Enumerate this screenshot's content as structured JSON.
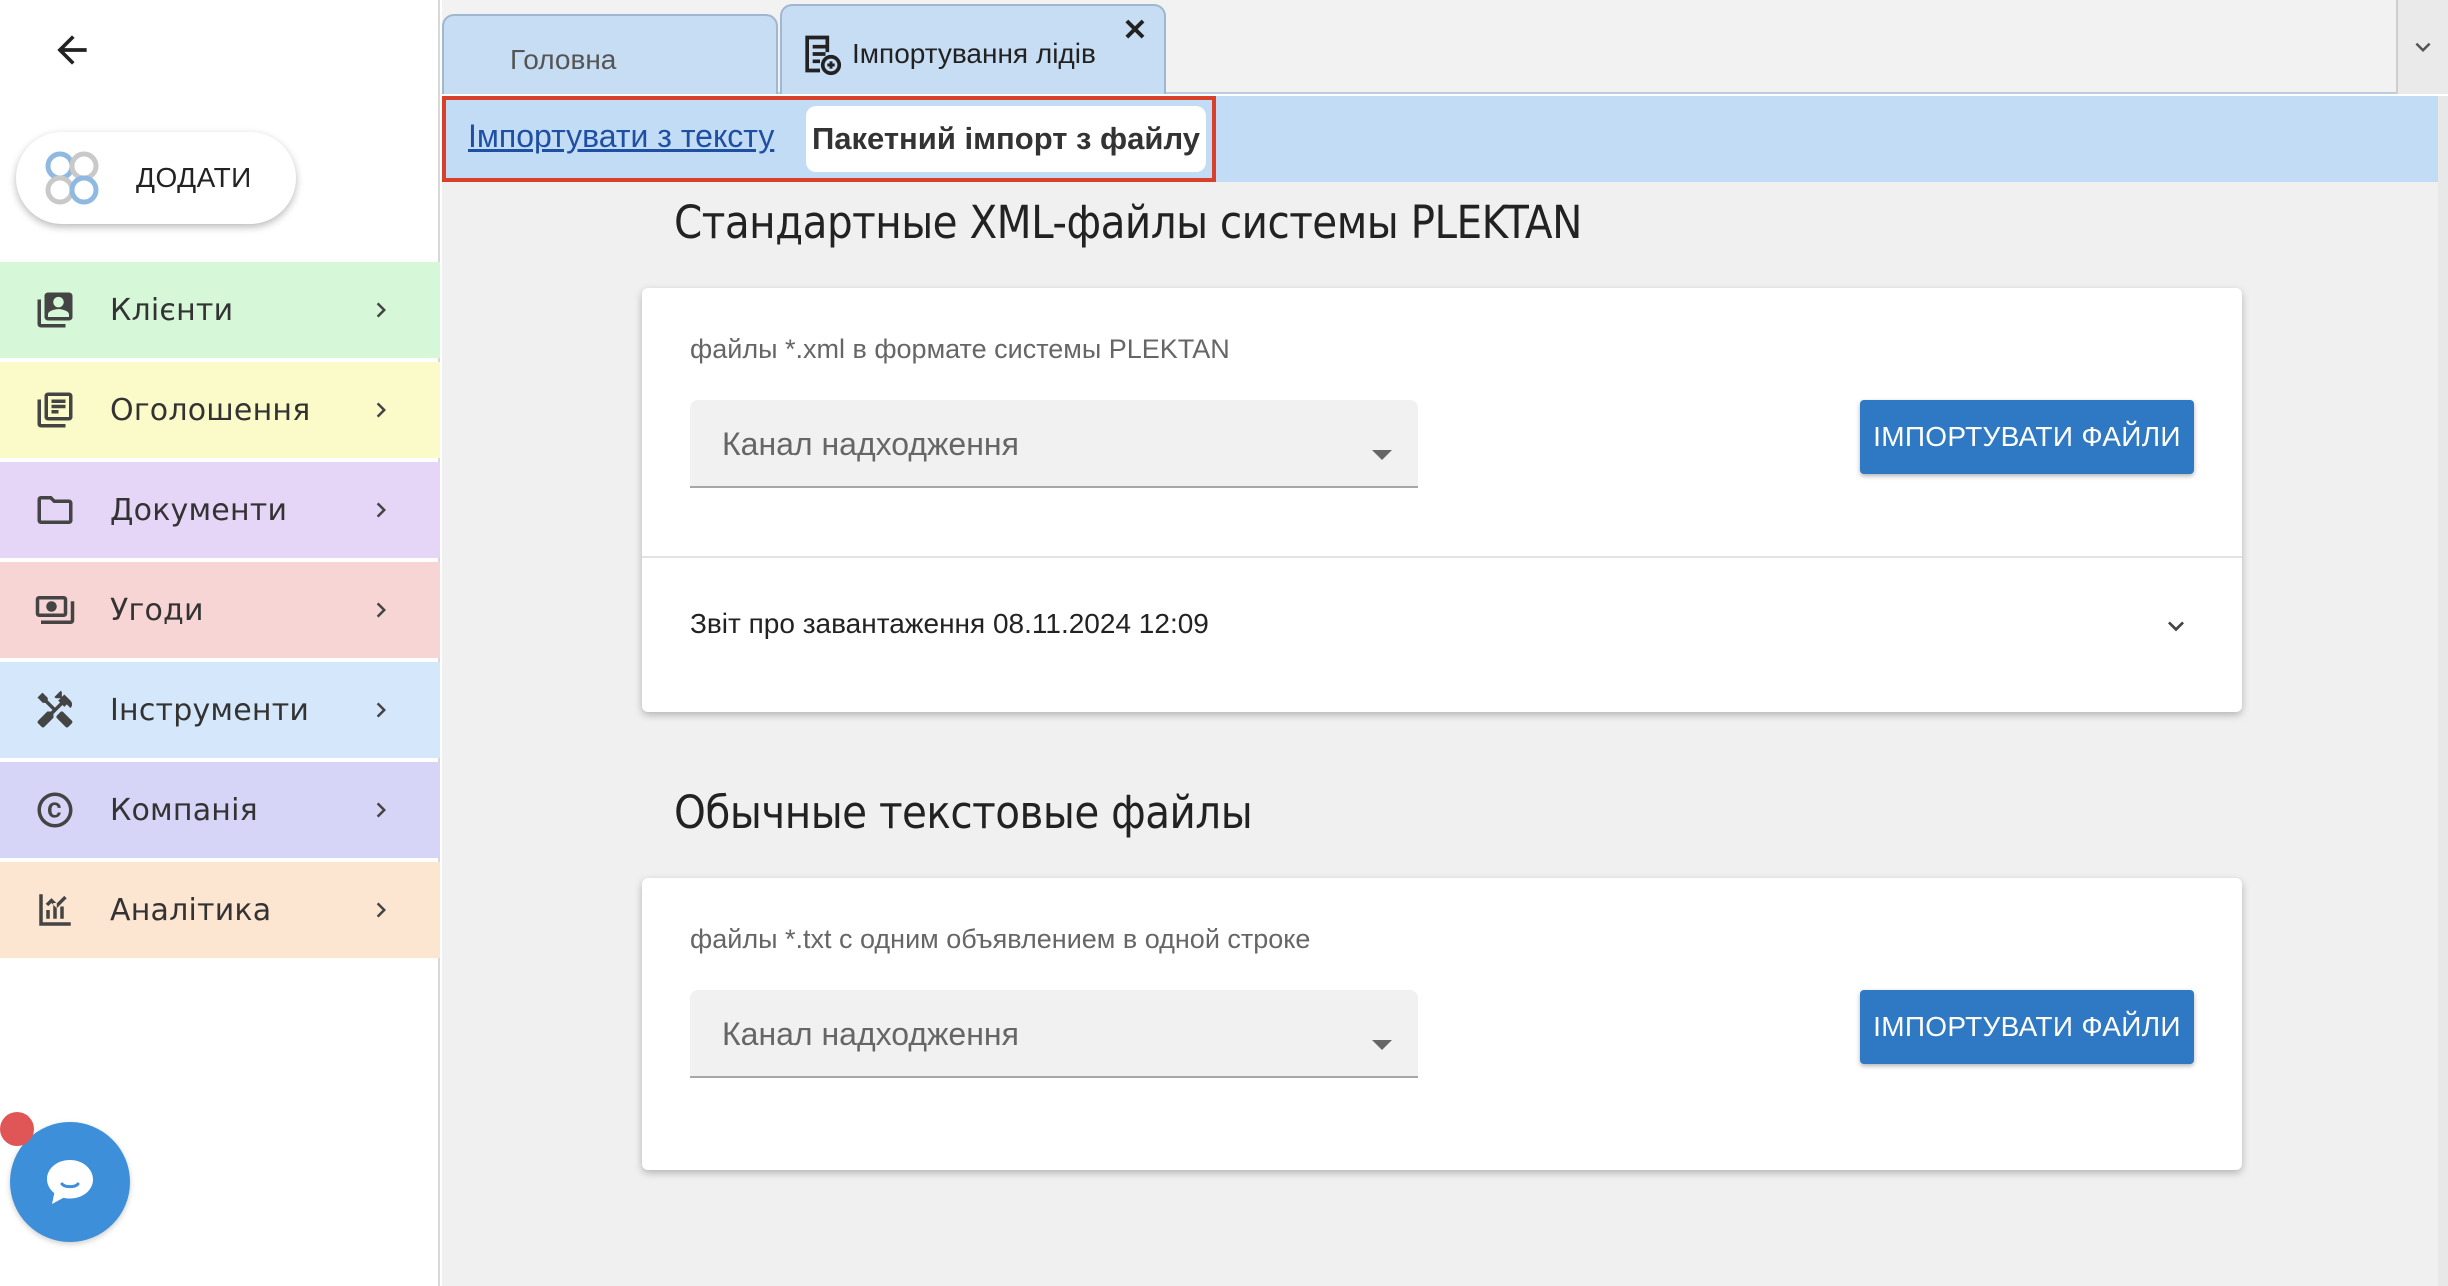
{
  "sidebar": {
    "add_label": "ДОДАТИ",
    "items": [
      {
        "label": "Клієнти",
        "icon": "contacts-icon",
        "color": "#d7f7d9"
      },
      {
        "label": "Оголошення",
        "icon": "listing-icon",
        "color": "#fbfbc9"
      },
      {
        "label": "Документи",
        "icon": "folder-icon",
        "color": "#e5d5f7"
      },
      {
        "label": "Угоди",
        "icon": "money-icon",
        "color": "#f8d5d5"
      },
      {
        "label": "Інструменти",
        "icon": "tools-icon",
        "color": "#d5e8fb"
      },
      {
        "label": "Компанія",
        "icon": "copyright-icon",
        "color": "#d7d5f7"
      },
      {
        "label": "Аналітика",
        "icon": "analytics-icon",
        "color": "#fce5d1"
      }
    ]
  },
  "tabs": {
    "home_label": "Головна",
    "import_label": "Імпортування лідів",
    "close_symbol": "✕"
  },
  "subtabs": {
    "text_import": "Імпортувати з тексту",
    "batch_import": "Пакетний імпорт з файлу"
  },
  "xml_section": {
    "title": "Стандартные XML-файлы системы PLEKTAN",
    "subtitle": "файлы *.xml в формате системы PLEKTAN",
    "channel_placeholder": "Канал надходження",
    "button_label": "ІМПОРТУВАТИ ФАЙЛИ",
    "report_label": "Звіт про завантаження 08.11.2024 12:09"
  },
  "txt_section": {
    "title": "Обычные текстовые файлы",
    "subtitle": "файлы *.txt с одним объявлением в одной строке",
    "channel_placeholder": "Канал надходження",
    "button_label": "ІМПОРТУВАТИ ФАЙЛИ"
  },
  "colors": {
    "accent": "#2f78c4",
    "tab_bg": "#c7ddf4",
    "highlight": "#d9402a"
  }
}
